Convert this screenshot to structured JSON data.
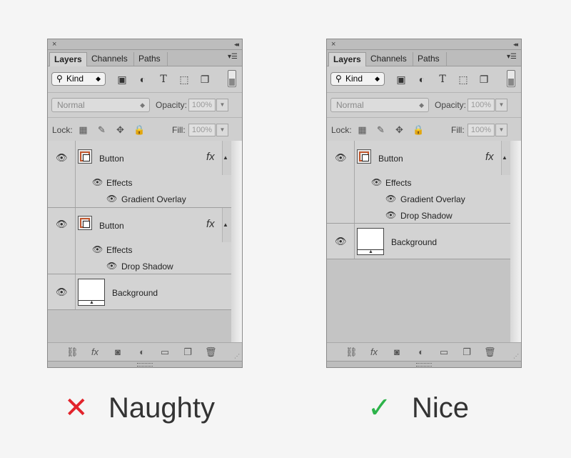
{
  "tabs": [
    "Layers",
    "Channels",
    "Paths"
  ],
  "filter": {
    "label": "Kind"
  },
  "blend": {
    "mode": "Normal",
    "opacity_label": "Opacity:",
    "opacity_value": "100%"
  },
  "lock": {
    "label": "Lock:",
    "fill_label": "Fill:",
    "fill_value": "100%"
  },
  "icons": {
    "close": "×",
    "collapse": "◂◂",
    "panel_menu": "▾☰",
    "fx": "fx",
    "eye": "👁",
    "type_tool": "T"
  },
  "colors": {
    "shape_accent": "#c0562d",
    "bad": "#e2232b",
    "good": "#2db34a"
  },
  "left_panel": {
    "layers": [
      {
        "name": "Button",
        "effects_label": "Effects",
        "effect": "Gradient Overlay"
      },
      {
        "name": "Button",
        "effects_label": "Effects",
        "effect": "Drop Shadow"
      },
      {
        "name": "Background"
      }
    ]
  },
  "right_panel": {
    "layers": [
      {
        "name": "Button",
        "effects_label": "Effects",
        "effects": [
          "Gradient Overlay",
          "Drop Shadow"
        ]
      },
      {
        "name": "Background"
      }
    ]
  },
  "captions": {
    "bad": {
      "mark": "✕",
      "text": "Naughty"
    },
    "good": {
      "mark": "✓",
      "text": "Nice"
    }
  }
}
